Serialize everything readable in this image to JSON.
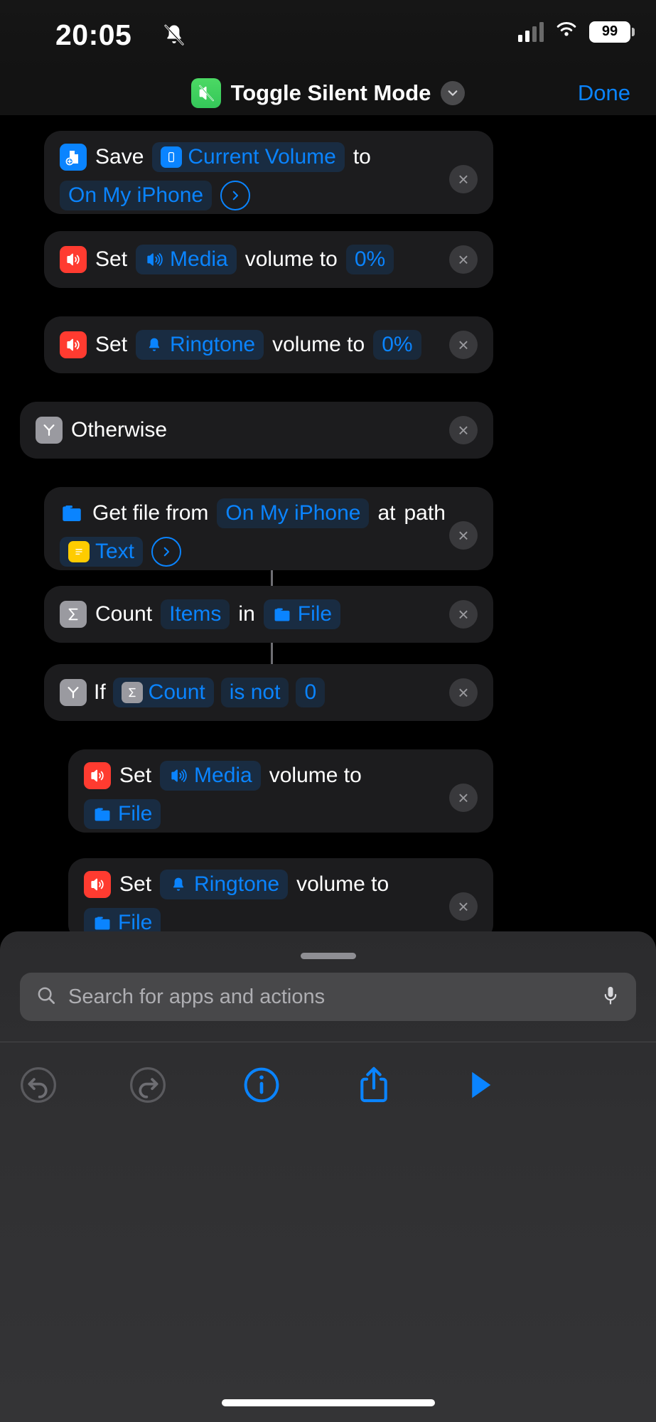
{
  "status_bar": {
    "time": "20:05",
    "silent_icon": "bell-slash-icon",
    "cellular_icon": "cellular-bars-icon",
    "wifi_icon": "wifi-icon",
    "battery_percent": "99"
  },
  "nav_bar": {
    "app_icon": "silent-mode-icon",
    "title": "Toggle Silent Mode",
    "chevron_icon": "chevron-down-icon",
    "done_label": "Done"
  },
  "actions": [
    {
      "id": "save-file",
      "glyph": "save-file-icon",
      "glyph_color": "#0a84ff",
      "tokens": [
        {
          "type": "text",
          "label": "Save"
        },
        {
          "type": "var",
          "label": "Current Volume",
          "icon": "iphone-icon",
          "icon_color": "#0a84ff"
        },
        {
          "type": "text",
          "label": "to"
        },
        {
          "type": "var",
          "label": "On My iPhone"
        },
        {
          "type": "disclosure",
          "label": "›"
        }
      ],
      "remove_label": "×"
    },
    {
      "id": "set-media-volume-0",
      "glyph": "volume-icon",
      "glyph_color": "#ff3b30",
      "tokens": [
        {
          "type": "text",
          "label": "Set"
        },
        {
          "type": "var",
          "label": "Media",
          "icon": "speaker-waves-icon"
        },
        {
          "type": "text",
          "label": "volume to"
        },
        {
          "type": "var",
          "label": "0%"
        }
      ],
      "remove_label": "×"
    },
    {
      "id": "set-ringtone-volume-0",
      "glyph": "volume-icon",
      "glyph_color": "#ff3b30",
      "tokens": [
        {
          "type": "text",
          "label": "Set"
        },
        {
          "type": "var",
          "label": "Ringtone",
          "icon": "bell-icon"
        },
        {
          "type": "text",
          "label": "volume to"
        },
        {
          "type": "var",
          "label": "0%"
        }
      ],
      "remove_label": "×"
    },
    {
      "id": "otherwise",
      "glyph": "if-branch-icon",
      "glyph_color": "#9a9aa0",
      "tokens": [
        {
          "type": "text",
          "label": "Otherwise"
        }
      ],
      "remove_label": "×"
    },
    {
      "id": "get-file",
      "glyph": "folder-icon",
      "glyph_color": "#0a84ff",
      "tokens": [
        {
          "type": "text",
          "label": "Get file from"
        },
        {
          "type": "var",
          "label": "On My iPhone"
        },
        {
          "type": "text",
          "label": "at"
        },
        {
          "type": "text",
          "label": "path"
        },
        {
          "type": "var",
          "label": "Text",
          "icon": "text-doc-icon",
          "icon_color": "#ffcc00"
        },
        {
          "type": "disclosure",
          "label": "›"
        }
      ],
      "remove_label": "×"
    },
    {
      "id": "count-items",
      "glyph": "sigma-icon",
      "glyph_color": "#9a9aa0",
      "tokens": [
        {
          "type": "text",
          "label": "Count"
        },
        {
          "type": "var",
          "label": "Items"
        },
        {
          "type": "text",
          "label": "in"
        },
        {
          "type": "var",
          "label": "File",
          "icon": "folder-icon",
          "icon_color": "#0a84ff"
        }
      ],
      "remove_label": "×"
    },
    {
      "id": "if-count",
      "glyph": "if-branch-icon",
      "glyph_color": "#9a9aa0",
      "tokens": [
        {
          "type": "text",
          "label": "If"
        },
        {
          "type": "var",
          "label": "Count",
          "icon": "sigma-icon",
          "icon_color": "#9a9aa0"
        },
        {
          "type": "var",
          "label": "is not"
        },
        {
          "type": "var",
          "label": "0"
        }
      ],
      "remove_label": "×"
    },
    {
      "id": "set-media-volume-file",
      "glyph": "volume-icon",
      "glyph_color": "#ff3b30",
      "tokens": [
        {
          "type": "text",
          "label": "Set"
        },
        {
          "type": "var",
          "label": "Media",
          "icon": "speaker-waves-icon"
        },
        {
          "type": "text",
          "label": "volume to"
        },
        {
          "type": "var",
          "label": "File",
          "icon": "folder-icon",
          "icon_color": "#0a84ff"
        }
      ],
      "remove_label": "×"
    },
    {
      "id": "set-ringtone-volume-file",
      "glyph": "volume-icon",
      "glyph_color": "#ff3b30",
      "tokens": [
        {
          "type": "text",
          "label": "Set"
        },
        {
          "type": "var",
          "label": "Ringtone",
          "icon": "bell-icon"
        },
        {
          "type": "text",
          "label": "volume to"
        },
        {
          "type": "var",
          "label": "File",
          "icon": "folder-icon",
          "icon_color": "#0a84ff"
        }
      ],
      "remove_label": "×"
    }
  ],
  "sheet": {
    "search": {
      "placeholder": "Search for apps and actions",
      "search_icon": "search-icon",
      "mic_icon": "microphone-icon"
    },
    "toolbar": [
      {
        "id": "undo",
        "icon": "undo-icon",
        "enabled": false
      },
      {
        "id": "redo",
        "icon": "redo-icon",
        "enabled": false
      },
      {
        "id": "info",
        "icon": "info-circle-icon",
        "enabled": true
      },
      {
        "id": "share",
        "icon": "share-icon",
        "enabled": true
      },
      {
        "id": "play",
        "icon": "play-icon",
        "enabled": true
      }
    ]
  },
  "colors": {
    "accent": "#0a84ff",
    "card": "#1c1c1e",
    "red": "#ff3b30",
    "green": "#34c759",
    "yellow": "#ffcc00",
    "gray": "#9a9aa0"
  }
}
